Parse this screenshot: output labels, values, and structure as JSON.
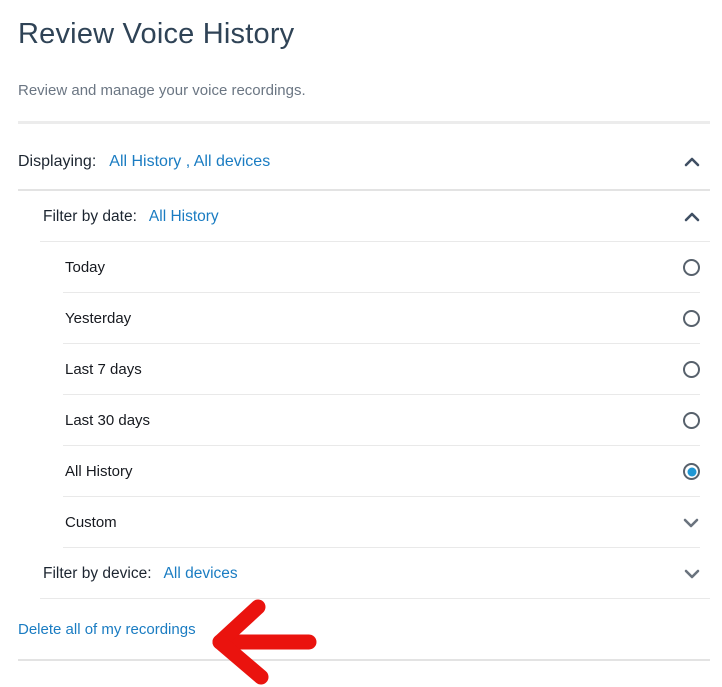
{
  "page": {
    "title": "Review Voice History",
    "subtitle": "Review and manage your voice recordings."
  },
  "displaying": {
    "label": "Displaying:",
    "value": "All History , All devices",
    "expanded": true
  },
  "filter_by_date": {
    "label": "Filter by date:",
    "value": "All History",
    "expanded": true,
    "options": [
      {
        "label": "Today",
        "control": "radio",
        "selected": false
      },
      {
        "label": "Yesterday",
        "control": "radio",
        "selected": false
      },
      {
        "label": "Last 7 days",
        "control": "radio",
        "selected": false
      },
      {
        "label": "Last 30 days",
        "control": "radio",
        "selected": false
      },
      {
        "label": "All History",
        "control": "radio",
        "selected": true
      },
      {
        "label": "Custom",
        "control": "chevron-down",
        "selected": false
      }
    ]
  },
  "filter_by_device": {
    "label": "Filter by device:",
    "value": "All devices",
    "expanded": false
  },
  "actions": {
    "delete_all_label": "Delete all of my recordings"
  },
  "annotations": {
    "red_arrow": "left-pointing arrow highlighting the delete link"
  },
  "colors": {
    "title": "#2f4356",
    "link_blue": "#1a7cc2",
    "radio_selected_blue": "#1f97d4",
    "arrow_red": "#ea130e",
    "divider_gray": "#e9e9e9"
  }
}
